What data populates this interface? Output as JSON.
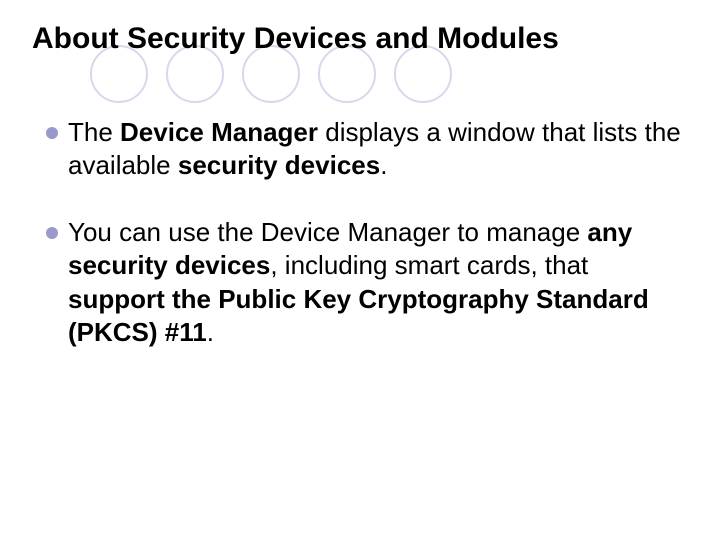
{
  "title": "About Security Devices and Modules",
  "bullets": [
    {
      "pre": "The ",
      "bold1": "Device Manager",
      "mid1": " displays a window that lists the available ",
      "bold2": "security devices",
      "post": "."
    },
    {
      "pre": "You can use the Device Manager to manage ",
      "bold1": "any security devices",
      "mid1": ", including smart cards, that ",
      "bold2": "support the Public Key Cryptography Standard (PKCS) #11",
      "post": "."
    }
  ]
}
